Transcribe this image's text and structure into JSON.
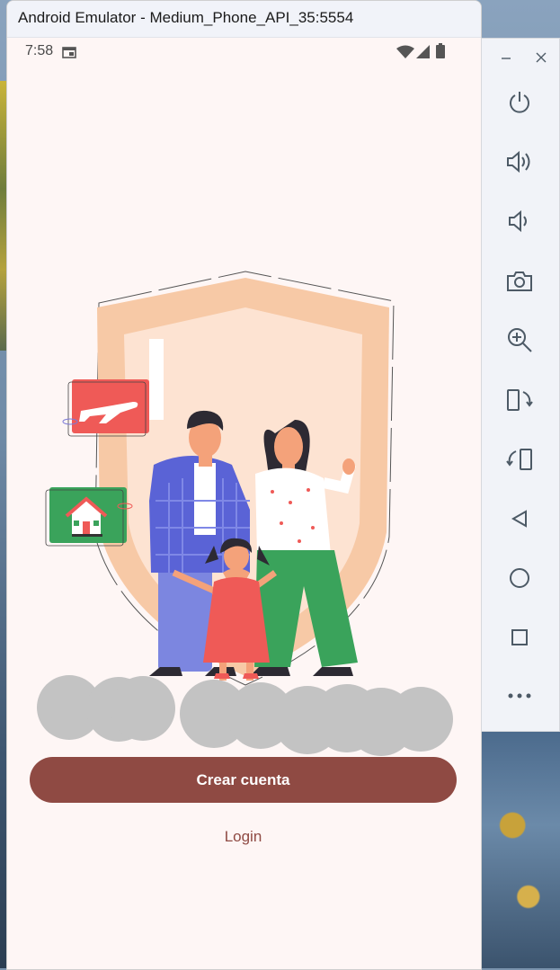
{
  "window": {
    "title": "Android Emulator - Medium_Phone_API_35:5554"
  },
  "status_bar": {
    "time": "7:58"
  },
  "screen": {
    "primary_button_label": "Crear cuenta",
    "secondary_link_label": "Login"
  },
  "toolbar": {
    "window_controls": [
      "minimize-icon",
      "close-icon"
    ],
    "buttons": [
      "power-icon",
      "volume-up-icon",
      "volume-down-icon",
      "camera-icon",
      "zoom-icon",
      "rotate-left-icon",
      "rotate-right-icon",
      "back-icon",
      "home-icon",
      "overview-icon",
      "more-icon"
    ]
  },
  "colors": {
    "accent": "#8f4a43",
    "background": "#fef6f5",
    "placeholder_blob": "#c3c3c3",
    "shield": "#f6c7a2",
    "jacket_blue": "#5a63d6",
    "pants_green": "#3aa35b",
    "dress_red": "#ef5a57"
  }
}
